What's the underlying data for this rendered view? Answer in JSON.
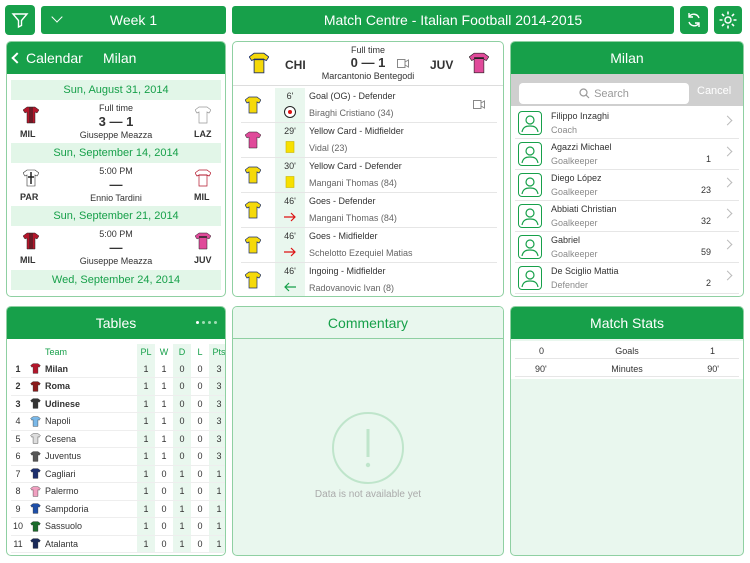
{
  "topbar": {
    "week_label": "Week 1",
    "title": "Match Centre - Italian Football 2014-2015"
  },
  "colors": {
    "accent": "#17a04a",
    "light": "#e9f7ee",
    "border": "#8fd0a2"
  },
  "calendar": {
    "back_label": "Calendar",
    "team": "Milan",
    "dates": [
      "Sun, August 31, 2014",
      "Sun, September 14, 2014",
      "Sun, September 21, 2014",
      "Wed, September 24, 2014"
    ],
    "matches": [
      {
        "status": "Full time",
        "score": "3 — 1",
        "home": "MIL",
        "away": "LAZ",
        "venue": "Giuseppe Meazza"
      },
      {
        "status": "5:00 PM",
        "score": "—",
        "home": "PAR",
        "away": "MIL",
        "venue": "Ennio Tardini"
      },
      {
        "status": "5:00 PM",
        "score": "—",
        "home": "MIL",
        "away": "JUV",
        "venue": "Giuseppe Meazza"
      }
    ]
  },
  "match": {
    "status": "Full time",
    "home": "CHI",
    "away": "JUV",
    "score": "0 — 1",
    "venue": "Marcantonio Bentegodi",
    "events": [
      {
        "minute": "6'",
        "title": "Goal (OG) - Defender",
        "player": "Biraghi Cristiano (34)",
        "icon": "ball-icon"
      },
      {
        "minute": "29'",
        "title": "Yellow Card - Midfielder",
        "player": "Vidal (23)",
        "icon": "yellow-card-icon"
      },
      {
        "minute": "30'",
        "title": "Yellow Card - Defender",
        "player": "Mangani Thomas (84)",
        "icon": "yellow-card-icon"
      },
      {
        "minute": "46'",
        "title": "Goes - Defender",
        "player": "Mangani Thomas (84)",
        "icon": "arrow-out-icon"
      },
      {
        "minute": "46'",
        "title": "Goes - Midfielder",
        "player": "Schelotto Ezequiel Matias",
        "icon": "arrow-out-icon"
      },
      {
        "minute": "46'",
        "title": "Ingoing - Midfielder",
        "player": "Radovanovic Ivan (8)",
        "icon": "arrow-in-icon"
      }
    ]
  },
  "squad": {
    "team": "Milan",
    "search_placeholder": "Search",
    "cancel_label": "Cancel",
    "players": [
      {
        "name": "Filippo Inzaghi",
        "role": "Coach",
        "number": ""
      },
      {
        "name": "Agazzi Michael",
        "role": "Goalkeeper",
        "number": "1"
      },
      {
        "name": "Diego López",
        "role": "Goalkeeper",
        "number": "23"
      },
      {
        "name": "Abbiati Christian",
        "role": "Goalkeeper",
        "number": "32"
      },
      {
        "name": "Gabriel",
        "role": "Goalkeeper",
        "number": "59"
      },
      {
        "name": "De Sciglio Mattia",
        "role": "Defender",
        "number": "2"
      }
    ]
  },
  "tables": {
    "title": "Tables",
    "headers": [
      "",
      "",
      "Team",
      "PL",
      "W",
      "D",
      "L",
      "Pts"
    ],
    "rows": [
      {
        "pos": "1",
        "team": "Milan",
        "pl": "1",
        "w": "1",
        "d": "0",
        "l": "0",
        "pts": "3",
        "bold": true,
        "shirt": "#b3162b"
      },
      {
        "pos": "2",
        "team": "Roma",
        "pl": "1",
        "w": "1",
        "d": "0",
        "l": "0",
        "pts": "3",
        "bold": true,
        "shirt": "#8b1a1a"
      },
      {
        "pos": "3",
        "team": "Udinese",
        "pl": "1",
        "w": "1",
        "d": "0",
        "l": "0",
        "pts": "3",
        "bold": true,
        "shirt": "#333333"
      },
      {
        "pos": "4",
        "team": "Napoli",
        "pl": "1",
        "w": "1",
        "d": "0",
        "l": "0",
        "pts": "3",
        "bold": false,
        "shirt": "#7ab8e8"
      },
      {
        "pos": "5",
        "team": "Cesena",
        "pl": "1",
        "w": "1",
        "d": "0",
        "l": "0",
        "pts": "3",
        "bold": false,
        "shirt": "#dddddd"
      },
      {
        "pos": "6",
        "team": "Juventus",
        "pl": "1",
        "w": "1",
        "d": "0",
        "l": "0",
        "pts": "3",
        "bold": false,
        "shirt": "#555555"
      },
      {
        "pos": "7",
        "team": "Cagliari",
        "pl": "1",
        "w": "0",
        "d": "1",
        "l": "0",
        "pts": "1",
        "bold": false,
        "shirt": "#1c2f6e"
      },
      {
        "pos": "8",
        "team": "Palermo",
        "pl": "1",
        "w": "0",
        "d": "1",
        "l": "0",
        "pts": "1",
        "bold": false,
        "shirt": "#f0a0c0"
      },
      {
        "pos": "9",
        "team": "Sampdoria",
        "pl": "1",
        "w": "0",
        "d": "1",
        "l": "0",
        "pts": "1",
        "bold": false,
        "shirt": "#1f4fa8"
      },
      {
        "pos": "10",
        "team": "Sassuolo",
        "pl": "1",
        "w": "0",
        "d": "1",
        "l": "0",
        "pts": "1",
        "bold": false,
        "shirt": "#1a6b2a"
      },
      {
        "pos": "11",
        "team": "Atalanta",
        "pl": "1",
        "w": "0",
        "d": "1",
        "l": "0",
        "pts": "1",
        "bold": false,
        "shirt": "#1a2a5a"
      }
    ]
  },
  "commentary": {
    "title": "Commentary",
    "empty_text": "Data is not available yet"
  },
  "stats": {
    "title": "Match Stats",
    "rows": [
      {
        "left": "0",
        "label": "Goals",
        "right": "1"
      },
      {
        "left": "90'",
        "label": "Minutes",
        "right": "90'"
      }
    ]
  }
}
